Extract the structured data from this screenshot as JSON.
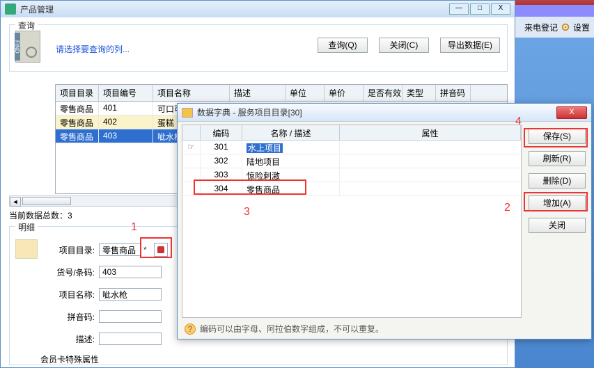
{
  "right_strip": {
    "register": "来电登记",
    "settings": "设置"
  },
  "main_window": {
    "title": "产品管理",
    "buttons": {
      "min": "—",
      "max": "□",
      "close": "X"
    }
  },
  "query": {
    "legend": "查询",
    "find_tab": "FIND",
    "link_text": "请选择要查询的列...",
    "buttons": {
      "query": "查询(Q)",
      "close": "关闭(C)",
      "export": "导出数据(E)"
    }
  },
  "table": {
    "headers": {
      "dir": "项目目录",
      "code": "项目编号",
      "name": "项目名称",
      "desc": "描述",
      "unit": "单位",
      "price": "单价",
      "valid": "是否有效",
      "type": "类型",
      "py": "拼音码"
    },
    "rows": [
      {
        "dir": "零售商品",
        "code": "401",
        "name": "可口可"
      },
      {
        "dir": "零售商品",
        "code": "402",
        "name": "蛋糕"
      },
      {
        "dir": "零售商品",
        "code": "403",
        "name": "呲水枪"
      }
    ],
    "total_label": "当前数据总数：3"
  },
  "detail": {
    "legend": "明细",
    "labels": {
      "dir": "项目目录:",
      "sku": "货号/条码:",
      "name": "项目名称:",
      "py": "拼音码:",
      "desc": "描述:",
      "vip": "会员卡特殊属性"
    },
    "values": {
      "dir": "零售商品",
      "sku": "403",
      "name": "呲水枪",
      "py": "",
      "desc": ""
    },
    "required_mark": "*"
  },
  "dialog": {
    "title": "数据字典 - 服务项目目录[30]",
    "headers": {
      "code": "编码",
      "name_desc": "名称 / 描述",
      "attr": "属性"
    },
    "rows": [
      {
        "code": "301",
        "name": "水上项目",
        "current": true
      },
      {
        "code": "302",
        "name": "陆地项目"
      },
      {
        "code": "303",
        "name": "惊险刺激"
      },
      {
        "code": "304",
        "name": "零售商品"
      }
    ],
    "buttons": {
      "save": "保存(S)",
      "refresh": "刷新(R)",
      "delete": "删除(D)",
      "add": "增加(A)",
      "close": "关闭"
    },
    "hint": "编码可以由字母、阿拉伯数字组成，不可以重复。",
    "close_x": "X"
  },
  "callouts": {
    "n1": "1",
    "n2": "2",
    "n3": "3",
    "n4": "4"
  }
}
